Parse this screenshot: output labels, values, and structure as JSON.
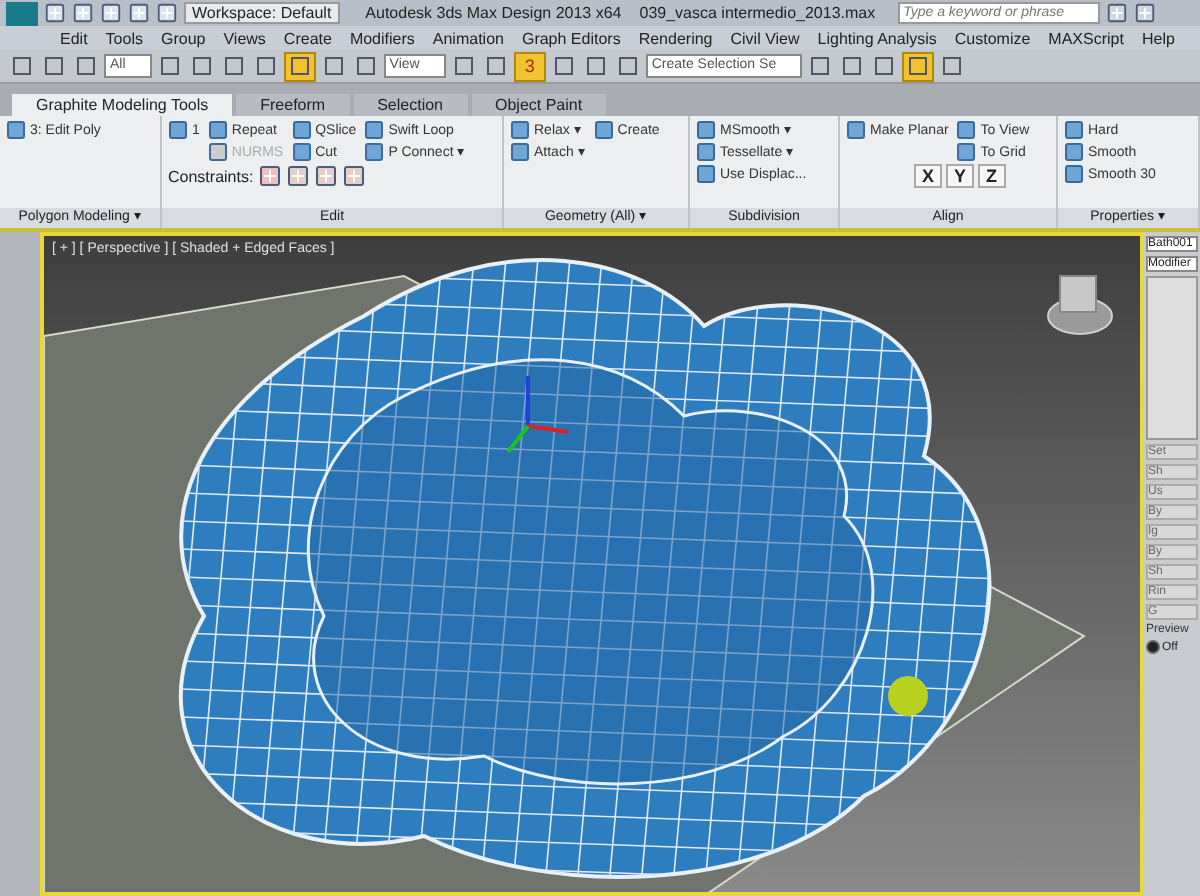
{
  "title_bar": {
    "workspace": "Workspace: Default",
    "title": "Autodesk 3ds Max Design 2013 x64",
    "file": "039_vasca intermedio_2013.max",
    "search": {
      "placeholder": "Type a keyword or phrase"
    }
  },
  "menu": [
    "Edit",
    "Tools",
    "Group",
    "Views",
    "Create",
    "Modifiers",
    "Animation",
    "Graph Editors",
    "Rendering",
    "Civil View",
    "Lighting Analysis",
    "Customize",
    "MAXScript",
    "Help"
  ],
  "toolbar": [
    {
      "kind": "icon",
      "on": false
    },
    {
      "kind": "icon",
      "on": false
    },
    {
      "kind": "icon",
      "on": false
    },
    {
      "kind": "dropdown",
      "value": "All"
    },
    {
      "kind": "icon",
      "on": false
    },
    {
      "kind": "icon",
      "on": false
    },
    {
      "kind": "icon",
      "on": false
    },
    {
      "kind": "icon",
      "on": false
    },
    {
      "kind": "icon",
      "on": true
    },
    {
      "kind": "icon",
      "on": false
    },
    {
      "kind": "icon",
      "on": false
    },
    {
      "kind": "dropdown",
      "value": "View"
    },
    {
      "kind": "icon",
      "on": false
    },
    {
      "kind": "icon",
      "on": false
    },
    {
      "kind": "snap",
      "label": "3",
      "on": true
    },
    {
      "kind": "icon",
      "on": false
    },
    {
      "kind": "icon",
      "on": false
    },
    {
      "kind": "icon",
      "on": false
    },
    {
      "kind": "dropdown",
      "value": "Create Selection Se"
    },
    {
      "kind": "icon",
      "on": false
    },
    {
      "kind": "icon",
      "on": false
    },
    {
      "kind": "icon",
      "on": false
    },
    {
      "kind": "icon",
      "on": true
    },
    {
      "kind": "icon",
      "on": false
    }
  ],
  "ribbon_tabs": [
    {
      "label": "Graphite Modeling Tools",
      "selected": true
    },
    {
      "label": "Freeform",
      "selected": false
    },
    {
      "label": "Selection",
      "selected": false
    },
    {
      "label": "Object Paint",
      "selected": false
    }
  ],
  "ribbon_panels": [
    {
      "title": "Polygon Modeling ▾",
      "columns": [
        [
          {
            "label": "3: Edit Poly",
            "disabled": false
          }
        ]
      ]
    },
    {
      "title": "Edit",
      "columns": [
        [
          {
            "label": "1",
            "disabled": false
          }
        ],
        [
          {
            "label": "Repeat",
            "disabled": false
          },
          {
            "label": "NURMS",
            "disabled": true
          }
        ],
        [
          {
            "label": "QSlice",
            "disabled": false
          },
          {
            "label": "Cut",
            "disabled": false
          }
        ],
        [
          {
            "label": "Swift Loop",
            "disabled": false
          },
          {
            "label": "P Connect ▾",
            "disabled": false
          }
        ]
      ],
      "footer_label": "Constraints:"
    },
    {
      "title": "Geometry (All) ▾",
      "columns": [
        [
          {
            "label": "Relax ▾",
            "disabled": false
          },
          {
            "label": "Attach ▾",
            "disabled": false
          }
        ],
        [
          {
            "label": "Create",
            "disabled": false
          }
        ]
      ]
    },
    {
      "title": "Subdivision",
      "columns": [
        [
          {
            "label": "MSmooth ▾",
            "disabled": false
          },
          {
            "label": "Tessellate ▾",
            "disabled": false
          },
          {
            "label": "Use Displac...",
            "disabled": false
          }
        ]
      ]
    },
    {
      "title": "Align",
      "columns": [
        [
          {
            "label": "Make Planar",
            "disabled": false
          }
        ],
        [
          {
            "label": "To View",
            "disabled": false
          },
          {
            "label": "To Grid",
            "disabled": false
          }
        ]
      ],
      "axes": [
        "X",
        "Y",
        "Z"
      ]
    },
    {
      "title": "Properties ▾",
      "columns": [
        [
          {
            "label": "Hard",
            "disabled": false
          },
          {
            "label": "Smooth",
            "disabled": false
          },
          {
            "label": "Smooth 30",
            "disabled": false
          }
        ]
      ]
    }
  ],
  "viewport": {
    "label": "[ + ] [ Perspective ] [ Shaded + Edged Faces ]"
  },
  "command_panel": {
    "name_field": "Bath001",
    "modifier_list": "Modifier",
    "texts": [
      "Set",
      "Sh",
      "Us",
      "By",
      "Ig",
      "By",
      "Sh",
      "Rin",
      "G"
    ],
    "preview_label": "Preview",
    "preview_option": {
      "label": "Off",
      "selected": true
    }
  }
}
